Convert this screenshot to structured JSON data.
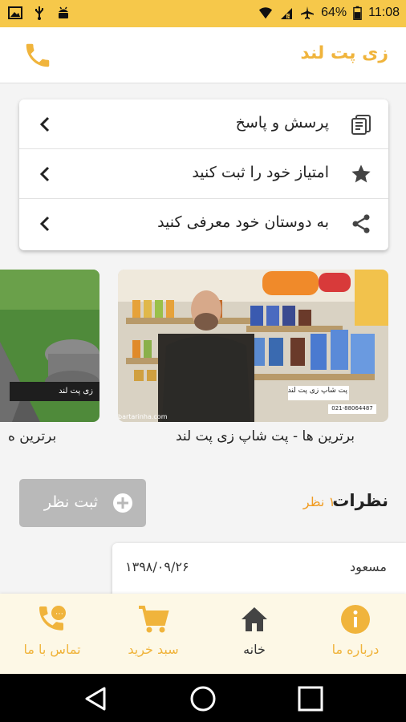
{
  "status": {
    "battery": "64%",
    "time": "11:08"
  },
  "appbar": {
    "title": "زی پت لند"
  },
  "menu": {
    "items": [
      {
        "label": "پرسش و پاسخ",
        "icon": "faq-icon"
      },
      {
        "label": "امتیاز خود را ثبت کنید",
        "icon": "star-icon"
      },
      {
        "label": "به دوستان خود معرفی کنید",
        "icon": "share-icon"
      }
    ]
  },
  "videos": [
    {
      "caption": "برترین ها - پت شاپ زی پت لند",
      "sign": "پت شاپ زی پت لند",
      "phone": "021-88064487",
      "site": "bartarinha.com"
    },
    {
      "caption": "برترین ه",
      "sign": "زی پت لند"
    }
  ],
  "comments": {
    "title": "نظرات",
    "count": "۱ نظر",
    "add_label": "ثبت نظر",
    "items": [
      {
        "author": "مسعود",
        "date": "۱۳۹۸/۰۹/۲۶"
      }
    ]
  },
  "bottomnav": {
    "items": [
      {
        "label": "درباره ما",
        "icon": "info-icon"
      },
      {
        "label": "خانه",
        "icon": "home-icon"
      },
      {
        "label": "سبد خرید",
        "icon": "cart-icon"
      },
      {
        "label": "تماس با ما",
        "icon": "phone-call-icon"
      }
    ]
  },
  "colors": {
    "accent": "#f0b43c",
    "statusbar": "#f6c84a",
    "count": "#f09c23",
    "add_button": "#b9b9b9"
  }
}
